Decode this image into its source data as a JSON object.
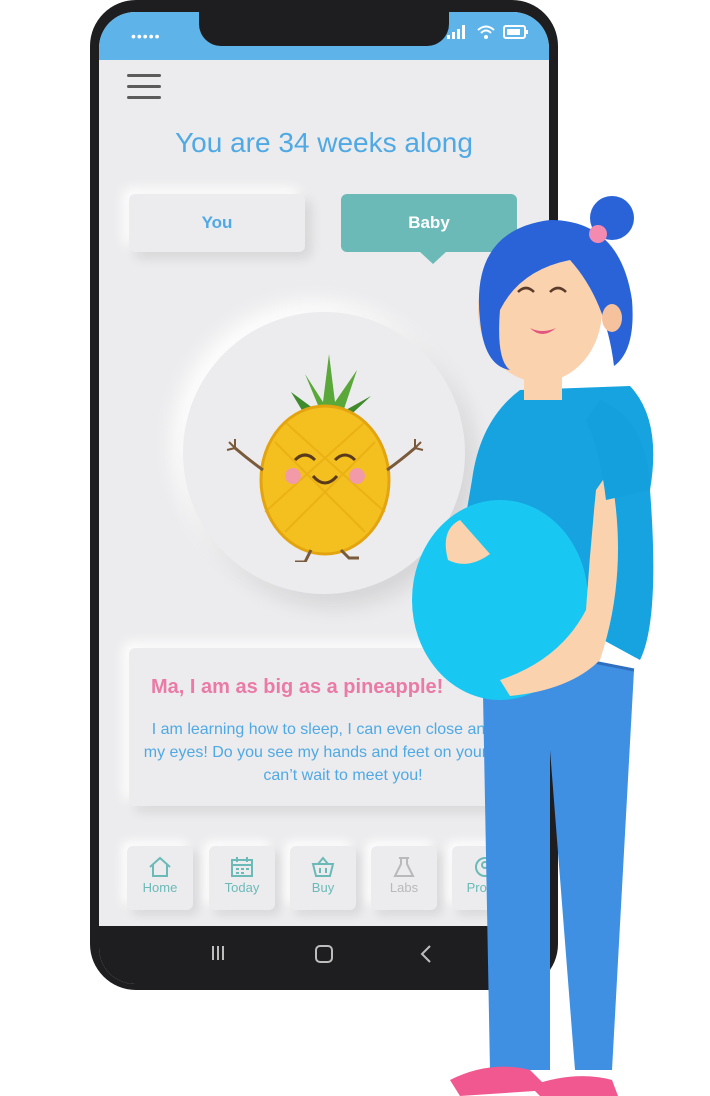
{
  "status_bar": {
    "dots": "•••••",
    "icons": [
      "signal-icon",
      "wifi-icon",
      "battery-icon"
    ]
  },
  "header": {
    "menu_icon": "hamburger-menu-icon",
    "title": "You are 34 weeks along"
  },
  "tabs": [
    {
      "label": "You",
      "active": false
    },
    {
      "label": "Baby",
      "active": true
    }
  ],
  "illustration": {
    "icon": "pineapple-icon"
  },
  "message": {
    "title": "Ma, I am as big as a pineapple!",
    "body": "I am learning how to sleep, I can even close and open my eyes! Do you see my hands and feet on your belly? I can’t wait to meet you!"
  },
  "bottom_nav": [
    {
      "label": "Home",
      "icon": "home-icon"
    },
    {
      "label": "Today",
      "icon": "calendar-icon"
    },
    {
      "label": "Buy",
      "icon": "shopping-basket-icon"
    },
    {
      "label": "Labs",
      "icon": "flask-icon"
    },
    {
      "label": "Profile",
      "icon": "profile-icon"
    }
  ],
  "system_nav": [
    "recent-apps-icon",
    "home-square-icon",
    "back-icon"
  ],
  "colors": {
    "accent_blue": "#4fa9e4",
    "teal": "#6bbab8",
    "pink": "#ea7aa6",
    "status_bar": "#5eb3e8",
    "background": "#ececee"
  }
}
